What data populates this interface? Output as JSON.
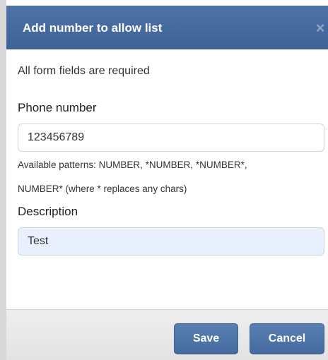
{
  "dialog": {
    "title": "Add number to allow list",
    "close_label": "×"
  },
  "form": {
    "required_note": "All form fields are required",
    "phone": {
      "label": "Phone number",
      "value": "123456789",
      "hint_line1": "Available patterns: NUMBER, *NUMBER, *NUMBER*,",
      "hint_line2": "NUMBER* (where * replaces any chars)"
    },
    "description": {
      "label": "Description",
      "value": "Test"
    }
  },
  "footer": {
    "save_label": "Save",
    "cancel_label": "Cancel"
  }
}
